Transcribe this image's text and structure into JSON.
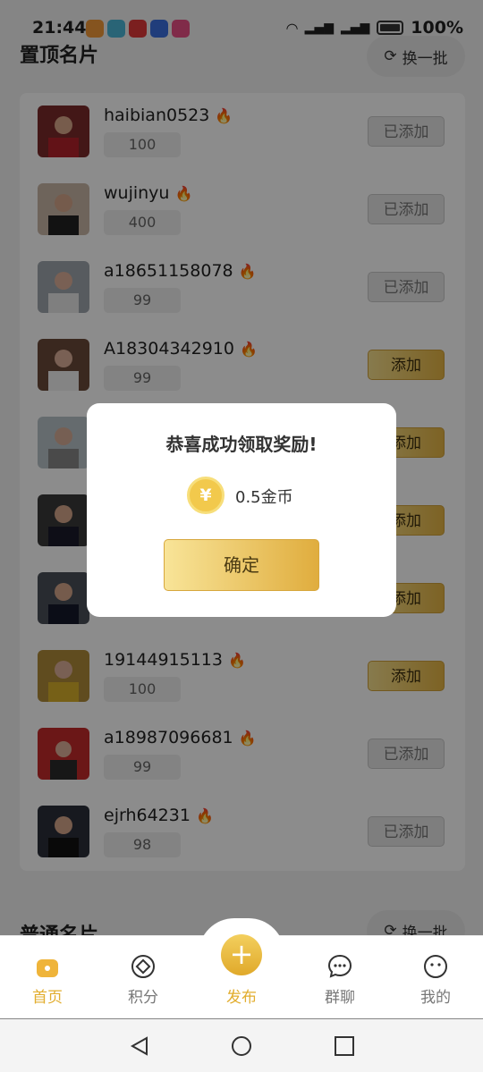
{
  "status_bar": {
    "time": "21:44",
    "battery": "100%"
  },
  "pinned": {
    "title": "置顶名片",
    "refresh_label": "换一批"
  },
  "normal": {
    "title": "普通名片",
    "refresh_label": "换一批"
  },
  "cards": [
    {
      "name": "haibian0523",
      "score": "100",
      "button": "已添加",
      "state": "added"
    },
    {
      "name": "wujinyu",
      "score": "400",
      "button": "已添加",
      "state": "added"
    },
    {
      "name": "a18651158078",
      "score": "99",
      "button": "已添加",
      "state": "added"
    },
    {
      "name": "A18304342910",
      "score": "99",
      "button": "添加",
      "state": "add"
    },
    {
      "name": "",
      "score": "",
      "button": "添加",
      "state": "add"
    },
    {
      "name": "",
      "score": "",
      "button": "添加",
      "state": "add"
    },
    {
      "name": "",
      "score": "",
      "button": "添加",
      "state": "add"
    },
    {
      "name": "19144915113",
      "score": "100",
      "button": "添加",
      "state": "add"
    },
    {
      "name": "a18987096681",
      "score": "99",
      "button": "已添加",
      "state": "added"
    },
    {
      "name": "ejrh64231",
      "score": "98",
      "button": "已添加",
      "state": "added"
    }
  ],
  "dialog": {
    "title": "恭喜成功领取奖励!",
    "coin_symbol": "¥",
    "reward": "0.5金币",
    "confirm": "确定"
  },
  "tabs": [
    {
      "label": "首页",
      "icon": "home-icon",
      "active": true
    },
    {
      "label": "积分",
      "icon": "points-icon",
      "active": false
    },
    {
      "label": "发布",
      "icon": "plus-icon",
      "active": true
    },
    {
      "label": "群聊",
      "icon": "chat-bubble-icon",
      "active": false
    },
    {
      "label": "我的",
      "icon": "profile-icon",
      "active": false
    }
  ],
  "colors": {
    "gold": "#e2ad2e",
    "overlay": "rgba(0,0,0,0.45)"
  }
}
